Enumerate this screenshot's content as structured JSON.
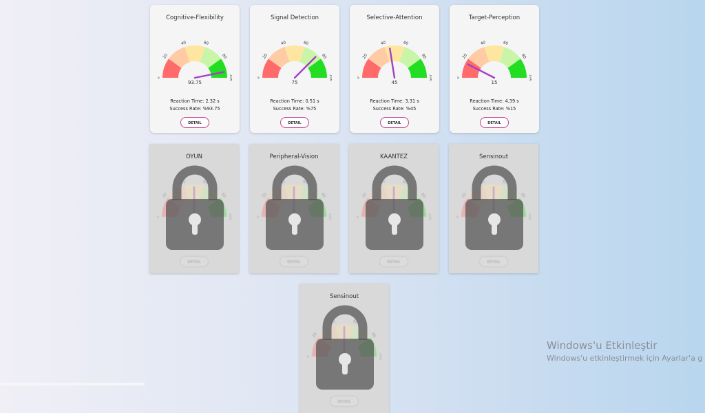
{
  "cards": [
    {
      "title": "Cognitive-Flexibility",
      "value": 93.75,
      "value_label": "93.75",
      "reaction": "Reaction Time: 2.32 s",
      "success": "Success Rate: %93.75",
      "detail": "DETAIL",
      "locked": false
    },
    {
      "title": "Signal Detection",
      "value": 75,
      "value_label": "75",
      "reaction": "Reaction Time: 0.51 s",
      "success": "Success Rate: %75",
      "detail": "DETAIL",
      "locked": false
    },
    {
      "title": "Selective-Attention",
      "value": 45,
      "value_label": "45",
      "reaction": "Reaction Time: 3.31 s",
      "success": "Success Rate: %45",
      "detail": "DETAIL",
      "locked": false
    },
    {
      "title": "Target-Perception",
      "value": 15,
      "value_label": "15",
      "reaction": "Reaction Time: 4.39 s",
      "success": "Success Rate: %15",
      "detail": "DETAIL",
      "locked": false
    },
    {
      "title": "OYUN",
      "value": 50,
      "detail": "DETAIL",
      "locked": true
    },
    {
      "title": "Peripheral-Vision",
      "value": 50,
      "detail": "DETAIL",
      "locked": true
    },
    {
      "title": "KAANTEZ",
      "value": 50,
      "detail": "DETAIL",
      "locked": true
    },
    {
      "title": "Sensinout",
      "value": 50,
      "detail": "DETAIL",
      "locked": true
    },
    {
      "title": "Sensinout",
      "value": 50,
      "detail": "DETAIL",
      "locked": true
    }
  ],
  "gauge": {
    "ticks": [
      "0",
      "20",
      "40",
      "60",
      "80",
      "100"
    ],
    "segment_colors": [
      "#ff6b6b",
      "#ffcba4",
      "#ffe6a0",
      "#c8f5a8",
      "#22dd22"
    ],
    "needle_color": "#a43fc4"
  },
  "watermark": {
    "line1": "Windows'u Etkinleştir",
    "line2": "Windows'u etkinleştirmek için Ayarlar'a g"
  }
}
